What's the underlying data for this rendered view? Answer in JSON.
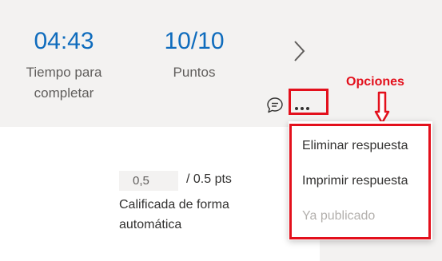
{
  "summary": {
    "time": {
      "value": "04:43",
      "label_line1": "Tiempo para",
      "label_line2": "completar"
    },
    "points": {
      "value": "10/10",
      "label": "Puntos"
    }
  },
  "icons": {
    "next": "chevron-right-icon",
    "comment": "comment-icon",
    "more": "more-options-icon"
  },
  "annotation": {
    "label": "Opciones",
    "color": "#e3101c"
  },
  "question": {
    "score_value": "0,5",
    "score_max": "/ 0.5 pts",
    "graded_status": "Calificada de forma automática"
  },
  "options_menu": {
    "items": [
      {
        "label": "Eliminar respuesta",
        "enabled": true
      },
      {
        "label": "Imprimir respuesta",
        "enabled": true
      },
      {
        "label": "Ya publicado",
        "enabled": false
      }
    ]
  },
  "colors": {
    "accent": "#0f6cbd",
    "card_background": "#f3f2f1",
    "text": "#323130",
    "muted_text": "#605e5c",
    "disabled_text": "#b3b0ad"
  }
}
